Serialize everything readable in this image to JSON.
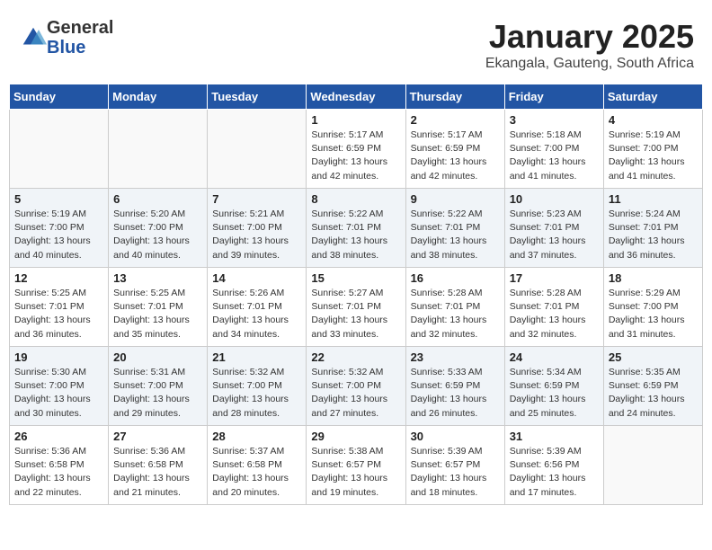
{
  "logo": {
    "general": "General",
    "blue": "Blue"
  },
  "header": {
    "month": "January 2025",
    "location": "Ekangala, Gauteng, South Africa"
  },
  "weekdays": [
    "Sunday",
    "Monday",
    "Tuesday",
    "Wednesday",
    "Thursday",
    "Friday",
    "Saturday"
  ],
  "weeks": [
    [
      {
        "day": null,
        "text": null
      },
      {
        "day": null,
        "text": null
      },
      {
        "day": null,
        "text": null
      },
      {
        "day": "1",
        "sunrise": "5:17 AM",
        "sunset": "6:59 PM",
        "daylight": "13 hours and 42 minutes."
      },
      {
        "day": "2",
        "sunrise": "5:17 AM",
        "sunset": "6:59 PM",
        "daylight": "13 hours and 42 minutes."
      },
      {
        "day": "3",
        "sunrise": "5:18 AM",
        "sunset": "7:00 PM",
        "daylight": "13 hours and 41 minutes."
      },
      {
        "day": "4",
        "sunrise": "5:19 AM",
        "sunset": "7:00 PM",
        "daylight": "13 hours and 41 minutes."
      }
    ],
    [
      {
        "day": "5",
        "sunrise": "5:19 AM",
        "sunset": "7:00 PM",
        "daylight": "13 hours and 40 minutes."
      },
      {
        "day": "6",
        "sunrise": "5:20 AM",
        "sunset": "7:00 PM",
        "daylight": "13 hours and 40 minutes."
      },
      {
        "day": "7",
        "sunrise": "5:21 AM",
        "sunset": "7:00 PM",
        "daylight": "13 hours and 39 minutes."
      },
      {
        "day": "8",
        "sunrise": "5:22 AM",
        "sunset": "7:01 PM",
        "daylight": "13 hours and 38 minutes."
      },
      {
        "day": "9",
        "sunrise": "5:22 AM",
        "sunset": "7:01 PM",
        "daylight": "13 hours and 38 minutes."
      },
      {
        "day": "10",
        "sunrise": "5:23 AM",
        "sunset": "7:01 PM",
        "daylight": "13 hours and 37 minutes."
      },
      {
        "day": "11",
        "sunrise": "5:24 AM",
        "sunset": "7:01 PM",
        "daylight": "13 hours and 36 minutes."
      }
    ],
    [
      {
        "day": "12",
        "sunrise": "5:25 AM",
        "sunset": "7:01 PM",
        "daylight": "13 hours and 36 minutes."
      },
      {
        "day": "13",
        "sunrise": "5:25 AM",
        "sunset": "7:01 PM",
        "daylight": "13 hours and 35 minutes."
      },
      {
        "day": "14",
        "sunrise": "5:26 AM",
        "sunset": "7:01 PM",
        "daylight": "13 hours and 34 minutes."
      },
      {
        "day": "15",
        "sunrise": "5:27 AM",
        "sunset": "7:01 PM",
        "daylight": "13 hours and 33 minutes."
      },
      {
        "day": "16",
        "sunrise": "5:28 AM",
        "sunset": "7:01 PM",
        "daylight": "13 hours and 32 minutes."
      },
      {
        "day": "17",
        "sunrise": "5:28 AM",
        "sunset": "7:01 PM",
        "daylight": "13 hours and 32 minutes."
      },
      {
        "day": "18",
        "sunrise": "5:29 AM",
        "sunset": "7:00 PM",
        "daylight": "13 hours and 31 minutes."
      }
    ],
    [
      {
        "day": "19",
        "sunrise": "5:30 AM",
        "sunset": "7:00 PM",
        "daylight": "13 hours and 30 minutes."
      },
      {
        "day": "20",
        "sunrise": "5:31 AM",
        "sunset": "7:00 PM",
        "daylight": "13 hours and 29 minutes."
      },
      {
        "day": "21",
        "sunrise": "5:32 AM",
        "sunset": "7:00 PM",
        "daylight": "13 hours and 28 minutes."
      },
      {
        "day": "22",
        "sunrise": "5:32 AM",
        "sunset": "7:00 PM",
        "daylight": "13 hours and 27 minutes."
      },
      {
        "day": "23",
        "sunrise": "5:33 AM",
        "sunset": "6:59 PM",
        "daylight": "13 hours and 26 minutes."
      },
      {
        "day": "24",
        "sunrise": "5:34 AM",
        "sunset": "6:59 PM",
        "daylight": "13 hours and 25 minutes."
      },
      {
        "day": "25",
        "sunrise": "5:35 AM",
        "sunset": "6:59 PM",
        "daylight": "13 hours and 24 minutes."
      }
    ],
    [
      {
        "day": "26",
        "sunrise": "5:36 AM",
        "sunset": "6:58 PM",
        "daylight": "13 hours and 22 minutes."
      },
      {
        "day": "27",
        "sunrise": "5:36 AM",
        "sunset": "6:58 PM",
        "daylight": "13 hours and 21 minutes."
      },
      {
        "day": "28",
        "sunrise": "5:37 AM",
        "sunset": "6:58 PM",
        "daylight": "13 hours and 20 minutes."
      },
      {
        "day": "29",
        "sunrise": "5:38 AM",
        "sunset": "6:57 PM",
        "daylight": "13 hours and 19 minutes."
      },
      {
        "day": "30",
        "sunrise": "5:39 AM",
        "sunset": "6:57 PM",
        "daylight": "13 hours and 18 minutes."
      },
      {
        "day": "31",
        "sunrise": "5:39 AM",
        "sunset": "6:56 PM",
        "daylight": "13 hours and 17 minutes."
      },
      {
        "day": null,
        "text": null
      }
    ]
  ],
  "labels": {
    "sunrise": "Sunrise:",
    "sunset": "Sunset:",
    "daylight": "Daylight:"
  }
}
